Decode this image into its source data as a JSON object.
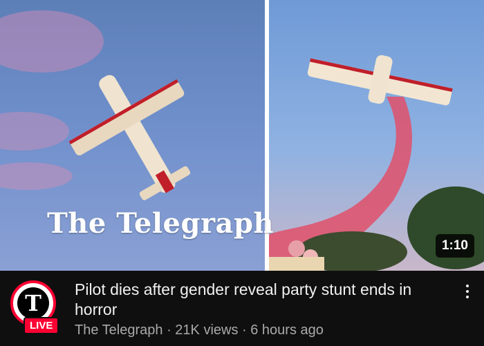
{
  "video": {
    "watermark": "The Telegraph",
    "duration": "1:10",
    "title": "Pilot dies after gender reveal party stunt ends in horror",
    "channel": "The Telegraph",
    "views": "21K views",
    "age": "6 hours ago",
    "byline_separator": "·",
    "live_badge": "LIVE"
  },
  "icons": {
    "avatar": "telegraph-logo-icon",
    "menu": "more-vert-icon"
  },
  "colors": {
    "live_red": "#ff0033",
    "background": "#0f0f0f",
    "title": "#f1f1f1",
    "meta_text": "#aaaaaa",
    "smoke_pink": "#e0506a"
  }
}
